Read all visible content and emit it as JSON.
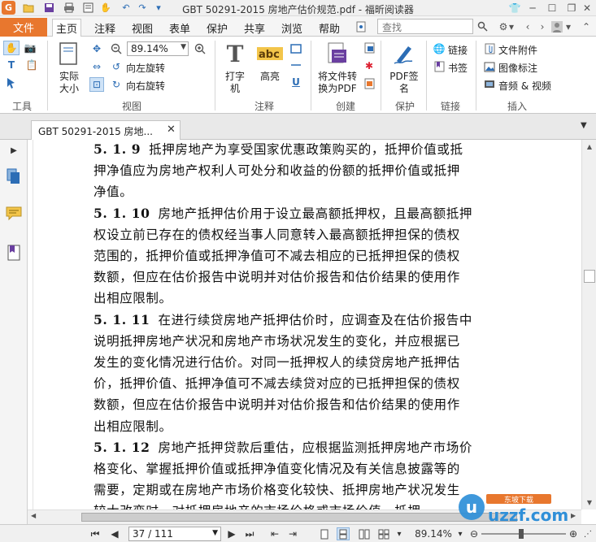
{
  "window": {
    "title": "GBT 50291-2015 房地产估价规范.pdf - 福昕阅读器"
  },
  "ribbon_tabs": [
    "文件",
    "主页",
    "注释",
    "视图",
    "表单",
    "保护",
    "共享",
    "浏览",
    "帮助"
  ],
  "search": {
    "placeholder": "查找"
  },
  "ribbon": {
    "tools_group": "工具",
    "view_group": "视图",
    "actual_size": "实际大小",
    "zoom_value": "89.14%",
    "rotate_left": "向左旋转",
    "rotate_right": "向右旋转",
    "comment_group": "注释",
    "typewriter": "打字机",
    "highlight": "高亮",
    "create_group": "创建",
    "to_pdf": "将文件转换为PDF",
    "protect_group": "保护",
    "pdf_sign": "PDF签名",
    "link_group": "链接",
    "link": "链接",
    "bookmark": "书签",
    "insert_group": "插入",
    "file_attachment": "文件附件",
    "image_annotation": "图像标注",
    "audio_video": "音频 & 视频"
  },
  "doc_tab": {
    "label": "GBT 50291-2015 房地..."
  },
  "document": {
    "lines": [
      {
        "num": "5. 1. 9",
        "text": "抵押房地产为享受国家优惠政策购买的，抵押价值或抵"
      },
      {
        "num": "",
        "text": "押净值应为房地产权利人可处分和收益的份额的抵押价值或抵押"
      },
      {
        "num": "",
        "text": "净值。"
      },
      {
        "num": "5. 1. 10",
        "text": "房地产抵押估价用于设立最高额抵押权，且最高额抵押"
      },
      {
        "num": "",
        "text": "权设立前已存在的债权经当事人同意转入最高额抵押担保的债权"
      },
      {
        "num": "",
        "text": "范围的，抵押价值或抵押净值可不减去相应的已抵押担保的债权"
      },
      {
        "num": "",
        "text": "数额，但应在估价报告中说明并对估价报告和估价结果的使用作"
      },
      {
        "num": "",
        "text": "出相应限制。"
      },
      {
        "num": "5. 1. 11",
        "text": "在进行续贷房地产抵押估价时，应调查及在估价报告中"
      },
      {
        "num": "",
        "text": "说明抵押房地产状况和房地产市场状况发生的变化，并应根据已"
      },
      {
        "num": "",
        "text": "发生的变化情况进行估价。对同一抵押权人的续贷房地产抵押估"
      },
      {
        "num": "",
        "text": "价，抵押价值、抵押净值可不减去续贷对应的已抵押担保的债权"
      },
      {
        "num": "",
        "text": "数额，但应在估价报告中说明并对估价报告和估价结果的使用作"
      },
      {
        "num": "",
        "text": "出相应限制。"
      },
      {
        "num": "5. 1. 12",
        "text": "房地产抵押贷款后重估，应根据监测抵押房地产市场价"
      },
      {
        "num": "",
        "text": "格变化、掌握抵押价值或抵押净值变化情况及有关信息披露等的"
      },
      {
        "num": "",
        "text": "需要，定期或在房地产市场价格变化较快、抵押房地产状况发生"
      },
      {
        "num": "",
        "text": "较大改变时，对抵押房地产的市场价格或市场价值、抵押"
      }
    ]
  },
  "statusbar": {
    "page_indicator": "37 / 111",
    "zoom_value": "89.14%"
  },
  "watermark": {
    "text": "uzzf.com",
    "subtext": "东坡下载"
  },
  "colors": {
    "accent": "#e8772e",
    "icon_blue": "#2c6db5"
  }
}
